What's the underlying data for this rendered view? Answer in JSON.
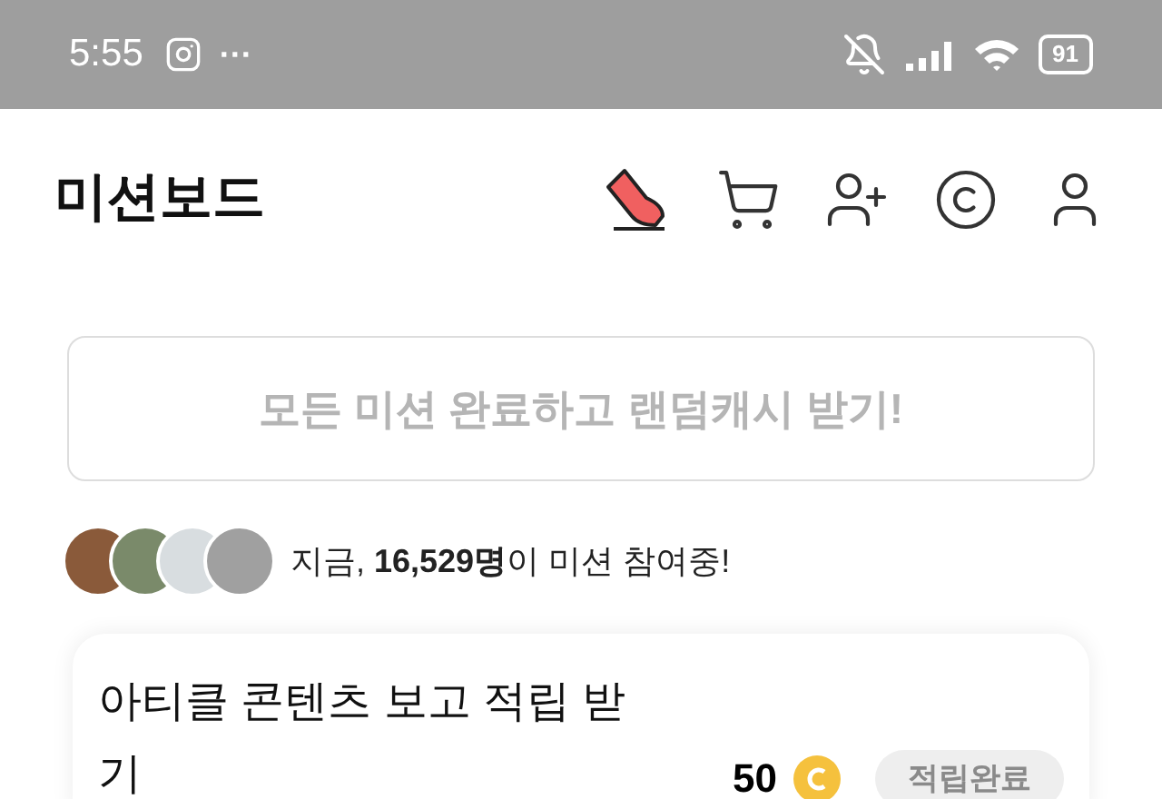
{
  "status_bar": {
    "time": "5:55",
    "more": "···",
    "battery": "91"
  },
  "header": {
    "title": "미션보드"
  },
  "banner": {
    "text": "모든 미션 완료하고 랜덤캐시 받기!"
  },
  "participants": {
    "text": "지금, **16,529명**이 미션 참여중!"
  },
  "missions": [
    {
      "title": "아티클 콘텐츠 보고 적립 받기",
      "reward": "50",
      "button": "적립완료",
      "disabled": true
    }
  ]
}
